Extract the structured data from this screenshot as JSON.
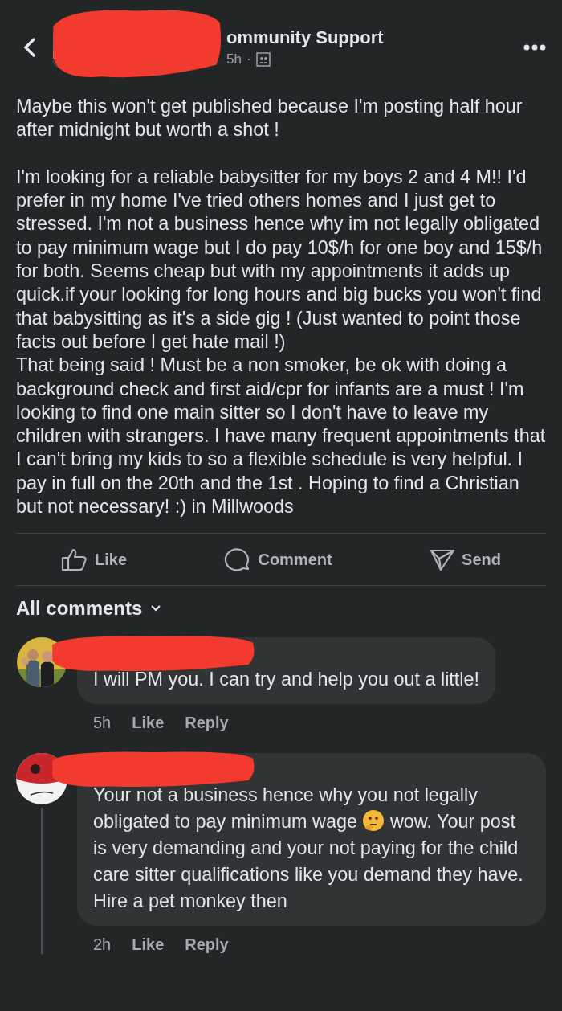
{
  "header": {
    "group_name": "ommunity Support",
    "time": "5h",
    "separator": "·"
  },
  "post": {
    "paragraphs": [
      "Maybe this won't get published because I'm posting half hour after midnight but worth a shot !",
      "I'm looking for a reliable babysitter for my boys 2 and 4 M!! I'd prefer in my home I've tried others homes and I just get to stressed. I'm not a business hence why im not legally obligated to pay minimum wage but I do pay 10$/h for one boy and 15$/h for both. Seems cheap but with my appointments it adds up quick.if your looking for long hours and big bucks you won't find that babysitting as it's a side gig ! (Just wanted to point those facts out before I get hate mail !)",
      "That being said ! Must be a non smoker, be ok with doing a background check and first aid/cpr for infants are a must ! I'm looking to find one main sitter so I don't have to leave my children with strangers. I have many frequent appointments that I can't bring my kids to so a flexible schedule is very helpful. I pay in full on the 20th and the 1st . Hoping to find a Christian but not necessary! :)  in Millwoods"
    ]
  },
  "actions": [
    {
      "kind": "like",
      "label": "Like"
    },
    {
      "kind": "comment",
      "label": "Comment"
    },
    {
      "kind": "send",
      "label": "Send"
    }
  ],
  "comments_filter": {
    "label": "All comments"
  },
  "comments": [
    {
      "parts": [
        "I will PM you. I can try and help you out a little!"
      ],
      "time": "5h",
      "like": "Like",
      "reply": "Reply",
      "thread": false
    },
    {
      "parts": [
        "Your not a business hence why you not legally obligated to pay minimum wage ",
        "wow. Your post is very demanding and your not paying for the child care sitter qualifications like you demand they have.  Hire a pet monkey then"
      ],
      "time": "2h",
      "like": "Like",
      "reply": "Reply",
      "thread": true
    }
  ]
}
